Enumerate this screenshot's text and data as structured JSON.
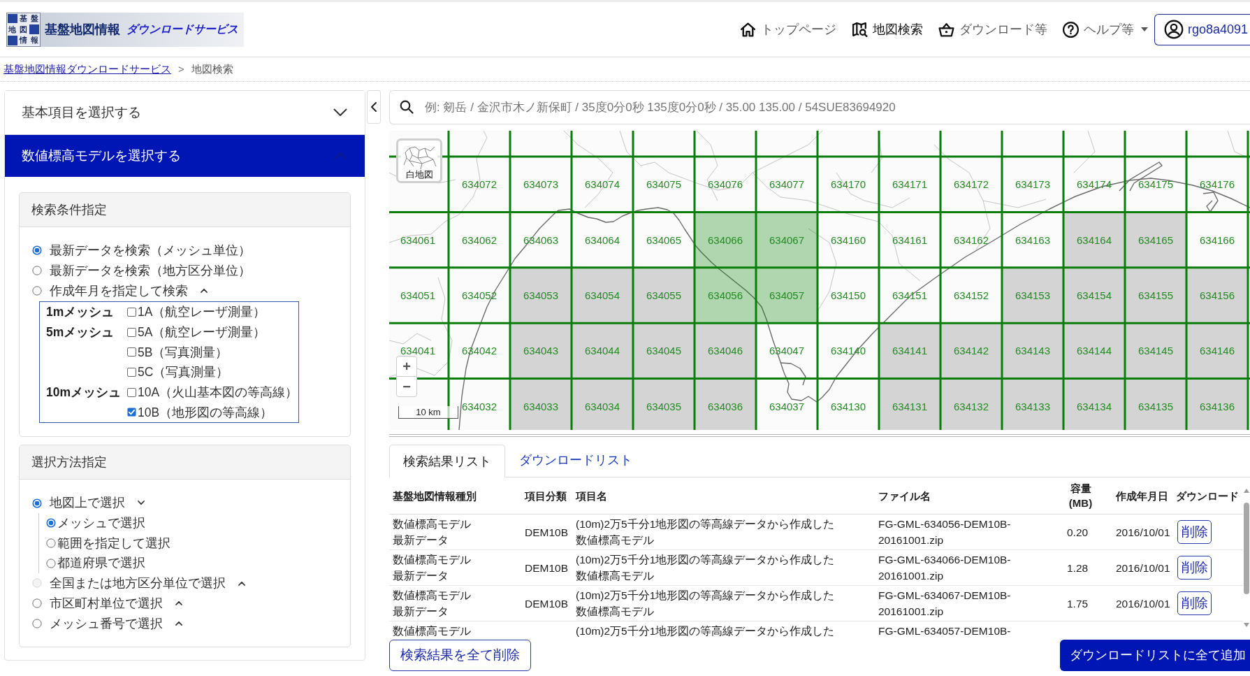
{
  "header": {
    "logo": {
      "mark": [
        "基",
        "盤",
        "地",
        "図",
        "情",
        "報"
      ],
      "title": "基盤地図情報",
      "subtitle": "ダウンロードサービス"
    },
    "nav": [
      {
        "label": "トップページ",
        "selected": false,
        "dropdown": false
      },
      {
        "label": "地図検索",
        "selected": true,
        "dropdown": false
      },
      {
        "label": "ダウンロード等",
        "selected": false,
        "dropdown": false
      },
      {
        "label": "ヘルプ等",
        "selected": false,
        "dropdown": true
      }
    ],
    "user": {
      "label": "rgo8a4091"
    }
  },
  "breadcrumb": {
    "items": [
      {
        "label": "基盤地図情報ダウンロードサービス",
        "link": true
      },
      {
        "label": "地図検索",
        "link": false
      }
    ],
    "separator": ">"
  },
  "sidebar": {
    "sections": [
      {
        "title": "基本項目を選択する",
        "expanded": false
      },
      {
        "title": "数値標高モデルを選択する",
        "expanded": true,
        "cards": [
          {
            "title": "検索条件指定",
            "options": [
              {
                "label": "最新データを検索（メッシュ単位）",
                "selected": true
              },
              {
                "label": "最新データを検索（地方区分単位）",
                "selected": false
              },
              {
                "label": "作成年月を指定して検索",
                "selected": false,
                "expanded": false
              }
            ],
            "mesh_groups": [
              {
                "label": "1mメッシュ",
                "options": [
                  {
                    "label": "1A（航空レーザ測量）",
                    "checked": false
                  }
                ]
              },
              {
                "label": "5mメッシュ",
                "options": [
                  {
                    "label": "5A（航空レーザ測量）",
                    "checked": false
                  },
                  {
                    "label": "5B（写真測量）",
                    "checked": false
                  },
                  {
                    "label": "5C（写真測量）",
                    "checked": false
                  }
                ]
              },
              {
                "label": "10mメッシュ",
                "options": [
                  {
                    "label": "10A（火山基本図の等高線）",
                    "checked": false
                  },
                  {
                    "label": "10B（地形図の等高線）",
                    "checked": true
                  }
                ]
              }
            ]
          },
          {
            "title": "選択方法指定",
            "options": [
              {
                "label": "地図上で選択",
                "selected": true,
                "disabled": false,
                "expanded": true,
                "children": [
                  {
                    "label": "メッシュで選択",
                    "selected": true
                  },
                  {
                    "label": "範囲を指定して選択",
                    "selected": false
                  },
                  {
                    "label": "都道府県で選択",
                    "selected": false
                  }
                ]
              },
              {
                "label": "全国または地方区分単位で選択",
                "selected": false,
                "disabled": true,
                "expanded": false
              },
              {
                "label": "市区町村単位で選択",
                "selected": false,
                "disabled": false,
                "expanded": false
              },
              {
                "label": "メッシュ番号で選択",
                "selected": false,
                "disabled": false,
                "expanded": false
              }
            ]
          }
        ]
      }
    ]
  },
  "search": {
    "placeholder": "例: 剱岳 / 金沢市木ノ新保町 / 35度0分0秒 135度0分0秒 / 35.00 135.00 / 54SUE83694920"
  },
  "map": {
    "basemap_button": {
      "label": "白地図"
    },
    "zoom_buttons": [
      "+",
      "−"
    ],
    "scale": "10 km",
    "rows": [
      {
        "cells": [
          {
            "available": true,
            "selected": false
          },
          {
            "label": "634072",
            "available": true,
            "selected": false
          },
          {
            "label": "634073",
            "available": true,
            "selected": false
          },
          {
            "label": "634074",
            "available": true,
            "selected": false
          },
          {
            "label": "634075",
            "available": true,
            "selected": false
          },
          {
            "label": "634076",
            "available": true,
            "selected": false
          },
          {
            "label": "634077",
            "available": true,
            "selected": false
          },
          {
            "label": "634170",
            "available": true,
            "selected": false
          },
          {
            "label": "634171",
            "available": true,
            "selected": false
          },
          {
            "label": "634172",
            "available": true,
            "selected": false
          },
          {
            "label": "634173",
            "available": true,
            "selected": false
          },
          {
            "label": "634174",
            "available": true,
            "selected": false
          },
          {
            "label": "634175",
            "available": true,
            "selected": false
          },
          {
            "label": "634176",
            "available": true,
            "selected": false
          }
        ]
      },
      {
        "cells": [
          {
            "label": "634061",
            "available": true,
            "selected": false
          },
          {
            "label": "634062",
            "available": true,
            "selected": false
          },
          {
            "label": "634063",
            "available": true,
            "selected": false
          },
          {
            "label": "634064",
            "available": true,
            "selected": false
          },
          {
            "label": "634065",
            "available": true,
            "selected": false
          },
          {
            "label": "634066",
            "available": true,
            "selected": true
          },
          {
            "label": "634067",
            "available": true,
            "selected": true
          },
          {
            "label": "634160",
            "available": true,
            "selected": false
          },
          {
            "label": "634161",
            "available": true,
            "selected": false
          },
          {
            "label": "634162",
            "available": true,
            "selected": false
          },
          {
            "label": "634163",
            "available": true,
            "selected": false
          },
          {
            "label": "634164",
            "available": false,
            "selected": false
          },
          {
            "label": "634165",
            "available": false,
            "selected": false
          },
          {
            "label": "634166",
            "available": true,
            "selected": false
          }
        ]
      },
      {
        "cells": [
          {
            "label": "634051",
            "available": true,
            "selected": false
          },
          {
            "label": "634052",
            "available": true,
            "selected": false
          },
          {
            "label": "634053",
            "available": false,
            "selected": false
          },
          {
            "label": "634054",
            "available": false,
            "selected": false
          },
          {
            "label": "634055",
            "available": false,
            "selected": false
          },
          {
            "label": "634056",
            "available": true,
            "selected": true
          },
          {
            "label": "634057",
            "available": true,
            "selected": true
          },
          {
            "label": "634150",
            "available": true,
            "selected": false
          },
          {
            "label": "634151",
            "available": true,
            "selected": false
          },
          {
            "label": "634152",
            "available": true,
            "selected": false
          },
          {
            "label": "634153",
            "available": false,
            "selected": false
          },
          {
            "label": "634154",
            "available": false,
            "selected": false
          },
          {
            "label": "634155",
            "available": false,
            "selected": false
          },
          {
            "label": "634156",
            "available": false,
            "selected": false
          }
        ]
      },
      {
        "cells": [
          {
            "label": "634041",
            "available": true,
            "selected": false
          },
          {
            "label": "634042",
            "available": true,
            "selected": false
          },
          {
            "label": "634043",
            "available": false,
            "selected": false
          },
          {
            "label": "634044",
            "available": false,
            "selected": false
          },
          {
            "label": "634045",
            "available": false,
            "selected": false
          },
          {
            "label": "634046",
            "available": false,
            "selected": false
          },
          {
            "label": "634047",
            "available": true,
            "selected": false
          },
          {
            "label": "634140",
            "available": true,
            "selected": false
          },
          {
            "label": "634141",
            "available": false,
            "selected": false
          },
          {
            "label": "634142",
            "available": false,
            "selected": false
          },
          {
            "label": "634143",
            "available": false,
            "selected": false
          },
          {
            "label": "634144",
            "available": false,
            "selected": false
          },
          {
            "label": "634145",
            "available": false,
            "selected": false
          },
          {
            "label": "634146",
            "available": false,
            "selected": false
          }
        ]
      },
      {
        "cells": [
          {
            "available": true,
            "selected": false
          },
          {
            "label": "634032",
            "available": true,
            "selected": false
          },
          {
            "label": "634033",
            "available": false,
            "selected": false
          },
          {
            "label": "634034",
            "available": false,
            "selected": false
          },
          {
            "label": "634035",
            "available": false,
            "selected": false
          },
          {
            "label": "634036",
            "available": false,
            "selected": false
          },
          {
            "label": "634037",
            "available": true,
            "selected": false
          },
          {
            "label": "634130",
            "available": true,
            "selected": false
          },
          {
            "label": "634131",
            "available": false,
            "selected": false
          },
          {
            "label": "634132",
            "available": false,
            "selected": false
          },
          {
            "label": "634133",
            "available": false,
            "selected": false
          },
          {
            "label": "634134",
            "available": false,
            "selected": false
          },
          {
            "label": "634135",
            "available": false,
            "selected": false
          },
          {
            "label": "634136",
            "available": false,
            "selected": false
          }
        ]
      }
    ]
  },
  "results": {
    "tabs": [
      {
        "label": "検索結果リスト",
        "selected": true
      },
      {
        "label": "ダウンロードリスト",
        "selected": false
      }
    ],
    "columns": [
      "基盤地図情報種別",
      "項目分類",
      "項目名",
      "ファイル名",
      "容量(MB)",
      "作成年月日",
      "ダウンロード"
    ],
    "rows": [
      {
        "type": "数値標高モデル最新データ",
        "class": "DEM10B",
        "name": "(10m)2万5千分1地形図の等高線データから作成した数値標高モデル",
        "file": "FG-GML-634056-DEM10B-\n20161001.zip",
        "size": "0.20",
        "date": "2016/10/01",
        "action": "削除"
      },
      {
        "type": "数値標高モデル最新データ",
        "class": "DEM10B",
        "name": "(10m)2万5千分1地形図の等高線データから作成した数値標高モデル",
        "file": "FG-GML-634066-DEM10B-\n20161001.zip",
        "size": "1.28",
        "date": "2016/10/01",
        "action": "削除"
      },
      {
        "type": "数値標高モデル最新データ",
        "class": "DEM10B",
        "name": "(10m)2万5千分1地形図の等高線データから作成した数値標高モデル",
        "file": "FG-GML-634067-DEM10B-\n20161001.zip",
        "size": "1.75",
        "date": "2016/10/01",
        "action": "削除"
      },
      {
        "type": "数値標高モデル",
        "name": "(10m)2万5千分1地形図の等高線データから作成した",
        "file": "FG-GML-634057-DEM10B-"
      }
    ]
  },
  "actions": [
    {
      "label": "検索結果を全て削除",
      "kind": "outline"
    },
    {
      "label": "ダウンロードリストに全て追加",
      "kind": "primary"
    }
  ]
}
